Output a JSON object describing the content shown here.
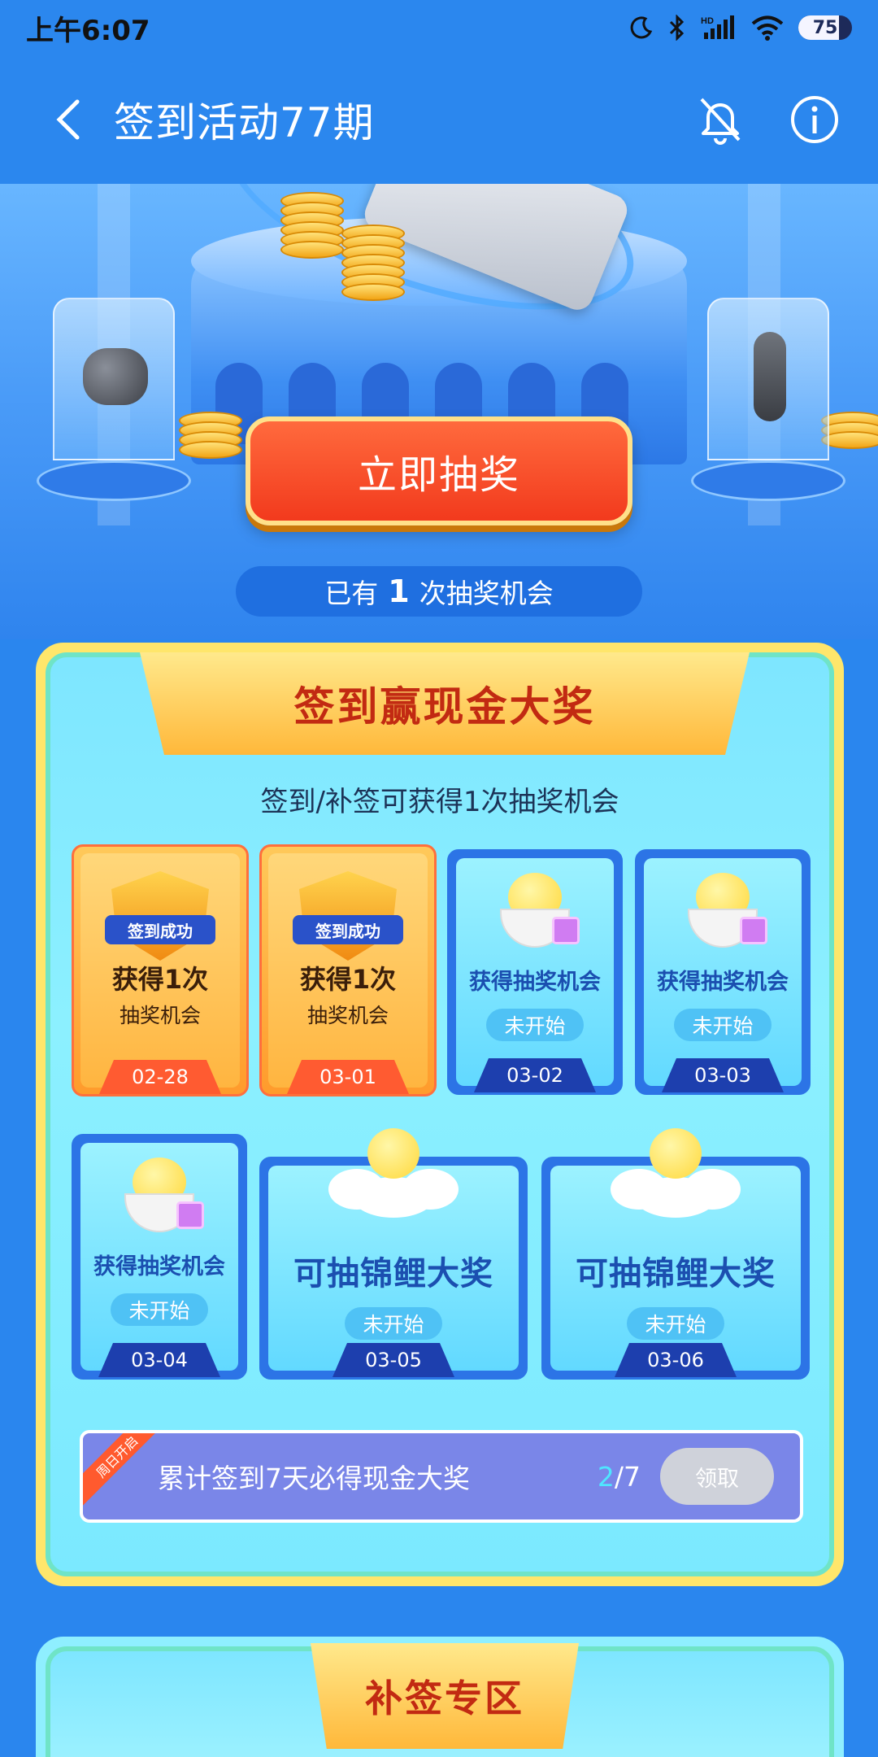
{
  "status_bar": {
    "time": "上午6:07",
    "battery": "75",
    "battery_level": 0.75
  },
  "header": {
    "title": "签到活动77期"
  },
  "hero": {
    "draw_button": "立即抽奖",
    "chances_prefix": "已有",
    "chances_count": "1",
    "chances_suffix": "次抽奖机会"
  },
  "checkin": {
    "banner": "签到赢现金大奖",
    "subtitle": "签到/补签可获得1次抽奖机会",
    "days": [
      {
        "date": "02-28",
        "state": "done",
        "badge": "签到成功",
        "main": "获得1次",
        "sub": "抽奖机会"
      },
      {
        "date": "03-01",
        "state": "done",
        "badge": "签到成功",
        "main": "获得1次",
        "sub": "抽奖机会"
      },
      {
        "date": "03-02",
        "state": "todo",
        "title": "获得抽奖机会",
        "status": "未开始"
      },
      {
        "date": "03-03",
        "state": "todo",
        "title": "获得抽奖机会",
        "status": "未开始"
      },
      {
        "date": "03-04",
        "state": "todo",
        "title": "获得抽奖机会",
        "status": "未开始"
      },
      {
        "date": "03-05",
        "state": "todo",
        "title": "可抽锦鲤大奖",
        "status": "未开始"
      },
      {
        "date": "03-06",
        "state": "todo",
        "title": "可抽锦鲤大奖",
        "status": "未开始"
      }
    ],
    "progress": {
      "tag": "周日开启",
      "text": "累计签到7天必得现金大奖",
      "current": "2",
      "total": "/7",
      "claim": "领取"
    }
  },
  "makeup": {
    "banner": "补签专区"
  }
}
